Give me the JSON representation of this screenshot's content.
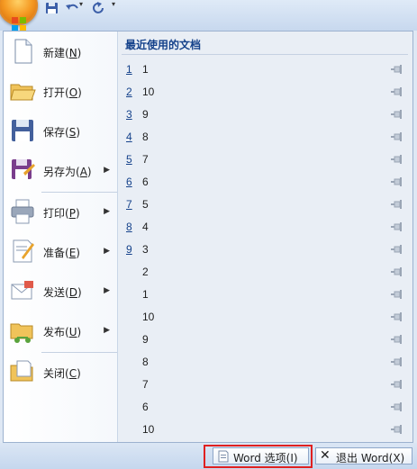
{
  "left_menu": {
    "items": [
      {
        "label": "新建(",
        "key": "N",
        "suffix": ")",
        "has_submenu": false,
        "icon": "new-document-icon"
      },
      {
        "label": "打开(",
        "key": "O",
        "suffix": ")",
        "has_submenu": false,
        "icon": "open-folder-icon"
      },
      {
        "label": "保存(",
        "key": "S",
        "suffix": ")",
        "has_submenu": false,
        "icon": "save-icon"
      },
      {
        "label": "另存为(",
        "key": "A",
        "suffix": ")",
        "has_submenu": true,
        "icon": "save-as-icon"
      },
      {
        "label": "打印(",
        "key": "P",
        "suffix": ")",
        "has_submenu": true,
        "icon": "print-icon"
      },
      {
        "label": "准备(",
        "key": "E",
        "suffix": ")",
        "has_submenu": true,
        "icon": "prepare-icon"
      },
      {
        "label": "发送(",
        "key": "D",
        "suffix": ")",
        "has_submenu": true,
        "icon": "send-icon"
      },
      {
        "label": "发布(",
        "key": "U",
        "suffix": ")",
        "has_submenu": true,
        "icon": "publish-icon"
      },
      {
        "label": "关闭(",
        "key": "C",
        "suffix": ")",
        "has_submenu": false,
        "icon": "close-document-icon"
      }
    ]
  },
  "recent": {
    "title": "最近使用的文档",
    "docs": [
      {
        "num": "1",
        "name": "1"
      },
      {
        "num": "2",
        "name": "10"
      },
      {
        "num": "3",
        "name": "9"
      },
      {
        "num": "4",
        "name": "8"
      },
      {
        "num": "5",
        "name": "7"
      },
      {
        "num": "6",
        "name": "6"
      },
      {
        "num": "7",
        "name": "5"
      },
      {
        "num": "8",
        "name": "4"
      },
      {
        "num": "9",
        "name": "3"
      },
      {
        "num": "",
        "name": "2"
      },
      {
        "num": "",
        "name": "1"
      },
      {
        "num": "",
        "name": "10"
      },
      {
        "num": "",
        "name": "9"
      },
      {
        "num": "",
        "name": "8"
      },
      {
        "num": "",
        "name": "7"
      },
      {
        "num": "",
        "name": "6"
      },
      {
        "num": "",
        "name": "10"
      }
    ]
  },
  "bottom": {
    "word_options": "Word 选项(I)",
    "exit_word": "退出 Word(X)"
  },
  "colors": {
    "highlight": "#e02020",
    "accent": "#15428b"
  }
}
